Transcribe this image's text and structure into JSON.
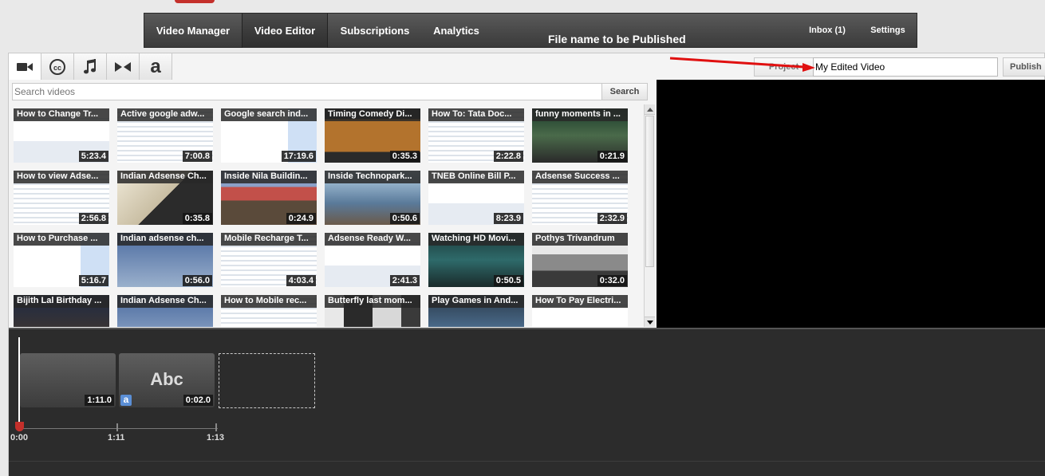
{
  "nav": {
    "tabs": [
      {
        "label": "Video Manager"
      },
      {
        "label": "Video Editor"
      },
      {
        "label": "Subscriptions"
      },
      {
        "label": "Analytics"
      }
    ],
    "inbox": "Inbox (1)",
    "settings": "Settings"
  },
  "annotation": {
    "text": "File name to be Published",
    "color": "#e01010"
  },
  "project": {
    "label": "Project",
    "title": "My Edited Video",
    "publish": "Publish"
  },
  "search": {
    "placeholder": "Search videos",
    "button": "Search"
  },
  "videos": [
    {
      "title": "How to Change Tr...",
      "duration": "5:23.4"
    },
    {
      "title": "Active google adw...",
      "duration": "7:00.8"
    },
    {
      "title": "Google search ind...",
      "duration": "17:19.6"
    },
    {
      "title": "Timing Comedy Di...",
      "duration": "0:35.3"
    },
    {
      "title": "How To: Tata Doc...",
      "duration": "2:22.8"
    },
    {
      "title": "funny moments in ...",
      "duration": "0:21.9"
    },
    {
      "title": "How to view Adse...",
      "duration": "2:56.8"
    },
    {
      "title": "Indian Adsense Ch...",
      "duration": "0:35.8"
    },
    {
      "title": "Inside Nila Buildin...",
      "duration": "0:24.9"
    },
    {
      "title": "Inside Technopark...",
      "duration": "0:50.6"
    },
    {
      "title": "TNEB Online Bill P...",
      "duration": "8:23.9"
    },
    {
      "title": "Adsense Success ...",
      "duration": "2:32.9"
    },
    {
      "title": "How to Purchase ...",
      "duration": "5:16.7"
    },
    {
      "title": "Indian adsense ch...",
      "duration": "0:56.0"
    },
    {
      "title": "Mobile Recharge T...",
      "duration": "4:03.4"
    },
    {
      "title": "Adsense Ready W...",
      "duration": "2:41.3"
    },
    {
      "title": "Watching HD Movi...",
      "duration": "0:50.5"
    },
    {
      "title": "Pothys Trivandrum",
      "duration": "0:32.0"
    },
    {
      "title": "Bijith Lal Birthday ...",
      "duration": ""
    },
    {
      "title": "Indian Adsense Ch...",
      "duration": ""
    },
    {
      "title": "How to Mobile rec...",
      "duration": ""
    },
    {
      "title": "Butterfly last mom...",
      "duration": ""
    },
    {
      "title": "Play Games in And...",
      "duration": ""
    },
    {
      "title": "How To Pay Electri...",
      "duration": ""
    }
  ],
  "timeline": {
    "clips": [
      {
        "duration": "1:11.0"
      },
      {
        "text": "Abc",
        "duration": "0:02.0",
        "icon": "a"
      }
    ],
    "ticks": [
      "0:00",
      "1:11",
      "1:13"
    ]
  },
  "colors": {
    "nav_bg": "#3a3a3a",
    "accent_red": "#c4302b",
    "text_icon_blue": "#5b8fd6"
  }
}
